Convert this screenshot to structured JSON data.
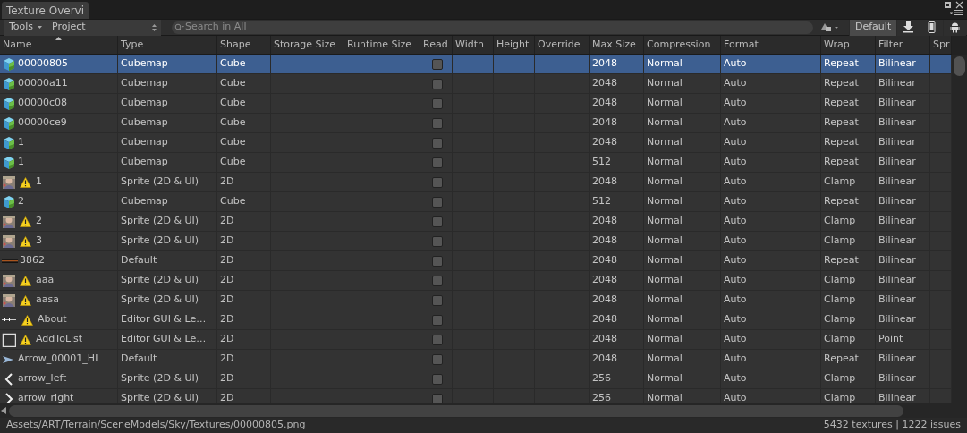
{
  "window": {
    "title": "Texture Overvi"
  },
  "toolbar": {
    "tools": "Tools",
    "scope": "Project",
    "search": {
      "placeholder": "Search in All"
    }
  },
  "platforms": [
    {
      "kind": "text",
      "label": "Default",
      "selected": true
    },
    {
      "kind": "download",
      "selected": false
    },
    {
      "kind": "phone",
      "selected": false
    },
    {
      "kind": "android",
      "selected": false
    }
  ],
  "table": {
    "columns": [
      "Name",
      "Type",
      "Shape",
      "Storage Size",
      "Runtime Size",
      "Read",
      "Width",
      "Height",
      "Override",
      "Max Size",
      "Compression",
      "Format",
      "Wrap",
      "Filter",
      "Spr"
    ],
    "rows": [
      {
        "kind": "cubemap",
        "warning": false,
        "name": "00000805",
        "type": "Cubemap",
        "shape": "Cube",
        "checked": false,
        "max_size": "2048",
        "compression": "Normal",
        "format": "Auto",
        "wrap": "Repeat",
        "filter": "Bilinear",
        "selected": true
      },
      {
        "kind": "cubemap",
        "warning": false,
        "name": "00000a11",
        "type": "Cubemap",
        "shape": "Cube",
        "checked": false,
        "max_size": "2048",
        "compression": "Normal",
        "format": "Auto",
        "wrap": "Repeat",
        "filter": "Bilinear",
        "selected": false
      },
      {
        "kind": "cubemap",
        "warning": false,
        "name": "00000c08",
        "type": "Cubemap",
        "shape": "Cube",
        "checked": false,
        "max_size": "2048",
        "compression": "Normal",
        "format": "Auto",
        "wrap": "Repeat",
        "filter": "Bilinear",
        "selected": false
      },
      {
        "kind": "cubemap",
        "warning": false,
        "name": "00000ce9",
        "type": "Cubemap",
        "shape": "Cube",
        "checked": false,
        "max_size": "2048",
        "compression": "Normal",
        "format": "Auto",
        "wrap": "Repeat",
        "filter": "Bilinear",
        "selected": false
      },
      {
        "kind": "cubemap",
        "warning": false,
        "name": "1",
        "type": "Cubemap",
        "shape": "Cube",
        "checked": false,
        "max_size": "2048",
        "compression": "Normal",
        "format": "Auto",
        "wrap": "Repeat",
        "filter": "Bilinear",
        "selected": false
      },
      {
        "kind": "cubemap",
        "warning": false,
        "name": "1",
        "type": "Cubemap",
        "shape": "Cube",
        "checked": false,
        "max_size": "512",
        "compression": "Normal",
        "format": "Auto",
        "wrap": "Repeat",
        "filter": "Bilinear",
        "selected": false
      },
      {
        "kind": "sprite",
        "warning": true,
        "name": "1",
        "type": "Sprite (2D & UI)",
        "shape": "2D",
        "checked": false,
        "max_size": "2048",
        "compression": "Normal",
        "format": "Auto",
        "wrap": "Clamp",
        "filter": "Bilinear",
        "selected": false
      },
      {
        "kind": "cubemap",
        "warning": false,
        "name": "2",
        "type": "Cubemap",
        "shape": "Cube",
        "checked": false,
        "max_size": "512",
        "compression": "Normal",
        "format": "Auto",
        "wrap": "Repeat",
        "filter": "Bilinear",
        "selected": false
      },
      {
        "kind": "sprite",
        "warning": true,
        "name": "2",
        "type": "Sprite (2D & UI)",
        "shape": "2D",
        "checked": false,
        "max_size": "2048",
        "compression": "Normal",
        "format": "Auto",
        "wrap": "Clamp",
        "filter": "Bilinear",
        "selected": false
      },
      {
        "kind": "sprite",
        "warning": true,
        "name": "3",
        "type": "Sprite (2D & UI)",
        "shape": "2D",
        "checked": false,
        "max_size": "2048",
        "compression": "Normal",
        "format": "Auto",
        "wrap": "Clamp",
        "filter": "Bilinear",
        "selected": false
      },
      {
        "kind": "strip",
        "warning": false,
        "name": "3862",
        "type": "Default",
        "shape": "2D",
        "checked": false,
        "max_size": "2048",
        "compression": "Normal",
        "format": "Auto",
        "wrap": "Repeat",
        "filter": "Bilinear",
        "selected": false
      },
      {
        "kind": "sprite",
        "warning": true,
        "name": "aaa",
        "type": "Sprite (2D & UI)",
        "shape": "2D",
        "checked": false,
        "max_size": "2048",
        "compression": "Normal",
        "format": "Auto",
        "wrap": "Clamp",
        "filter": "Bilinear",
        "selected": false
      },
      {
        "kind": "sprite",
        "warning": true,
        "name": "aasa",
        "type": "Sprite (2D & UI)",
        "shape": "2D",
        "checked": false,
        "max_size": "2048",
        "compression": "Normal",
        "format": "Auto",
        "wrap": "Clamp",
        "filter": "Bilinear",
        "selected": false
      },
      {
        "kind": "dots",
        "warning": true,
        "name": "About",
        "type": "Editor GUI & Le…",
        "shape": "2D",
        "checked": false,
        "max_size": "2048",
        "compression": "Normal",
        "format": "Auto",
        "wrap": "Clamp",
        "filter": "Bilinear",
        "selected": false
      },
      {
        "kind": "frame",
        "warning": true,
        "name": "AddToList",
        "type": "Editor GUI & Le…",
        "shape": "2D",
        "checked": false,
        "max_size": "2048",
        "compression": "Normal",
        "format": "Auto",
        "wrap": "Clamp",
        "filter": "Point",
        "selected": false
      },
      {
        "kind": "arrow",
        "warning": false,
        "name": "Arrow_00001_HL",
        "type": "Default",
        "shape": "2D",
        "checked": false,
        "max_size": "2048",
        "compression": "Normal",
        "format": "Auto",
        "wrap": "Repeat",
        "filter": "Bilinear",
        "selected": false
      },
      {
        "kind": "chevron-left",
        "warning": false,
        "name": "arrow_left",
        "type": "Sprite (2D & UI)",
        "shape": "2D",
        "checked": false,
        "max_size": "256",
        "compression": "Normal",
        "format": "Auto",
        "wrap": "Clamp",
        "filter": "Bilinear",
        "selected": false
      },
      {
        "kind": "chevron-right",
        "warning": false,
        "name": "arrow_right",
        "type": "Sprite (2D & UI)",
        "shape": "2D",
        "checked": false,
        "max_size": "256",
        "compression": "Normal",
        "format": "Auto",
        "wrap": "Clamp",
        "filter": "Bilinear",
        "selected": false
      }
    ]
  },
  "status_bar": {
    "path": "Assets/ART/Terrain/SceneModels/Sky/Textures/00000805.png",
    "summary": "5432 textures | 1222 issues"
  }
}
